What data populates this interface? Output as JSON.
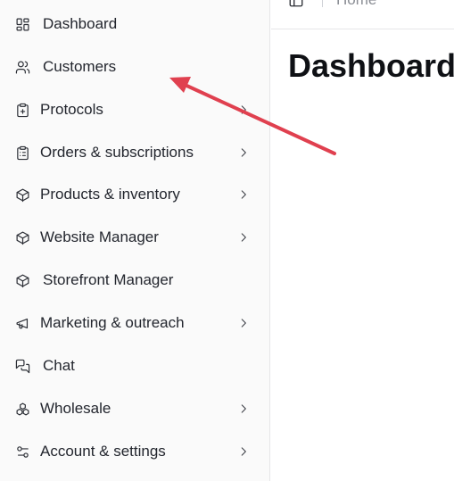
{
  "sidebar": {
    "items": [
      {
        "label": "Dashboard",
        "icon": "dashboard-icon",
        "chevron": false
      },
      {
        "label": "Customers",
        "icon": "users-icon",
        "chevron": false
      },
      {
        "label": "Protocols",
        "icon": "clipboard-plus-icon",
        "chevron": true
      },
      {
        "label": "Orders & subscriptions",
        "icon": "clipboard-list-icon",
        "chevron": true
      },
      {
        "label": "Products & inventory",
        "icon": "box-icon",
        "chevron": true
      },
      {
        "label": "Website Manager",
        "icon": "box-icon",
        "chevron": true
      },
      {
        "label": "Storefront Manager",
        "icon": "box-icon",
        "chevron": false
      },
      {
        "label": "Marketing & outreach",
        "icon": "megaphone-icon",
        "chevron": true
      },
      {
        "label": "Chat",
        "icon": "chat-icon",
        "chevron": false
      },
      {
        "label": "Wholesale",
        "icon": "boxes-icon",
        "chevron": true
      },
      {
        "label": "Account & settings",
        "icon": "sliders-icon",
        "chevron": true
      }
    ]
  },
  "header": {
    "breadcrumb": "Home",
    "panel_icon": "sidebar-toggle-icon"
  },
  "main": {
    "title": "Dashboard"
  },
  "annotation": {
    "color": "#e0404f",
    "target": "Customers"
  }
}
